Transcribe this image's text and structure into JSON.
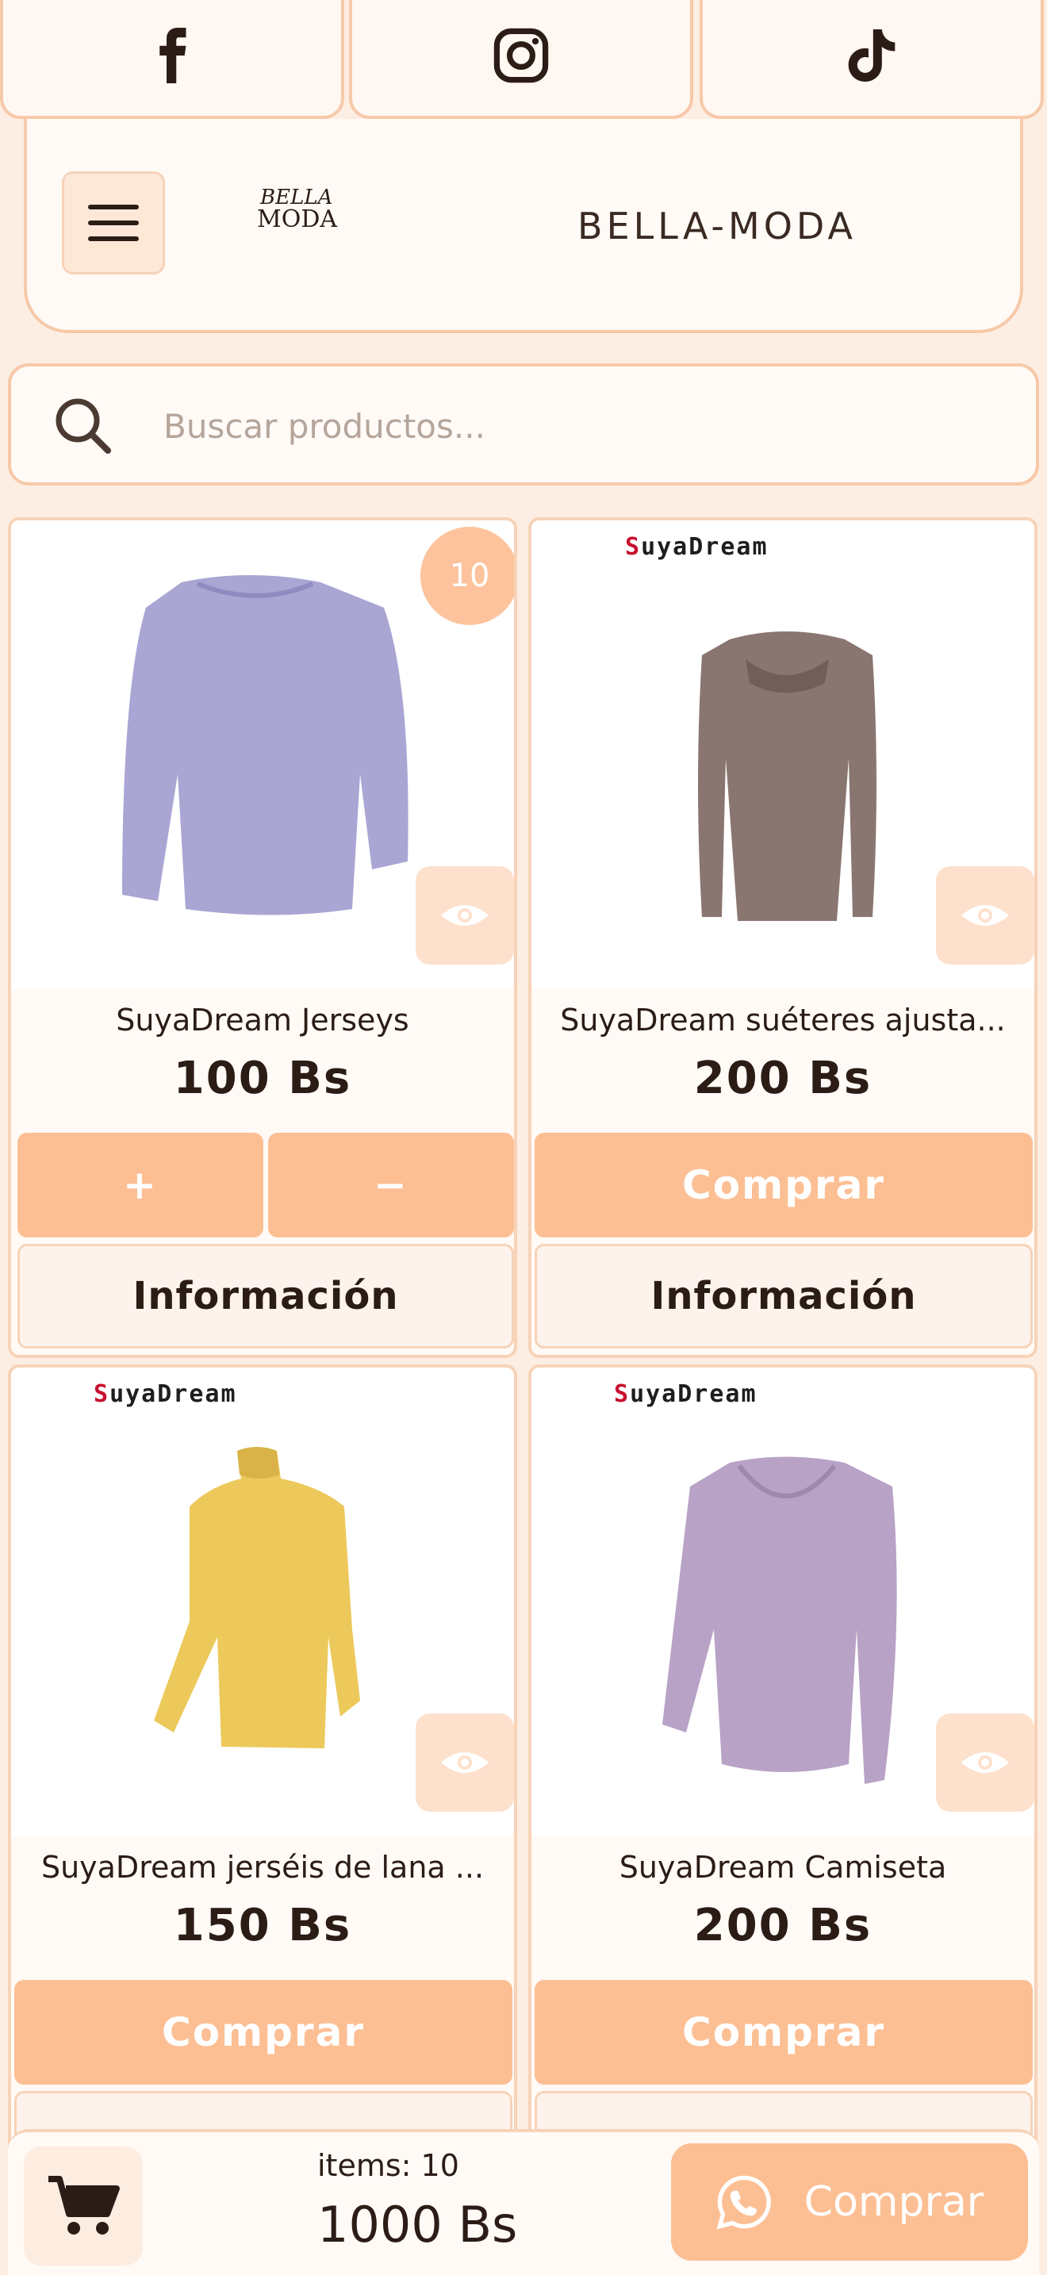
{
  "social": {
    "items": [
      {
        "icon": "facebook-icon"
      },
      {
        "icon": "instagram-icon"
      },
      {
        "icon": "tiktok-icon"
      }
    ]
  },
  "header": {
    "logo_line1": "BELLA",
    "logo_line2": "MODA",
    "brand": "BELLA-MODA"
  },
  "search": {
    "placeholder": "Buscar productos..."
  },
  "products": [
    {
      "name": "SuyaDream Jerseys",
      "price": "100 Bs",
      "badge": "10",
      "plus": "+",
      "minus": "−",
      "info": "Información",
      "color": "#a9a6d4"
    },
    {
      "name": "SuyaDream suéteres ajusta...",
      "price": "200 Bs",
      "buy": "Comprar",
      "info": "Información",
      "brand_s": "S",
      "brand_rest": "uyaDream",
      "color": "#8a7670"
    },
    {
      "name": "SuyaDream jerséis de lana ...",
      "price": "150 Bs",
      "buy": "Comprar",
      "brand_s": "S",
      "brand_rest": "uyaDream",
      "color": "#ecc95a"
    },
    {
      "name": "SuyaDream Camiseta",
      "price": "200 Bs",
      "buy": "Comprar",
      "brand_s": "S",
      "brand_rest": "uyaDream",
      "color": "#b8a2c6"
    }
  ],
  "cart": {
    "items_label": "items: 10",
    "total": "1000 Bs",
    "checkout_label": "Comprar"
  },
  "colors": {
    "accent": "#fcbf94",
    "border": "#f7c9a9",
    "background": "#fdeee3"
  }
}
